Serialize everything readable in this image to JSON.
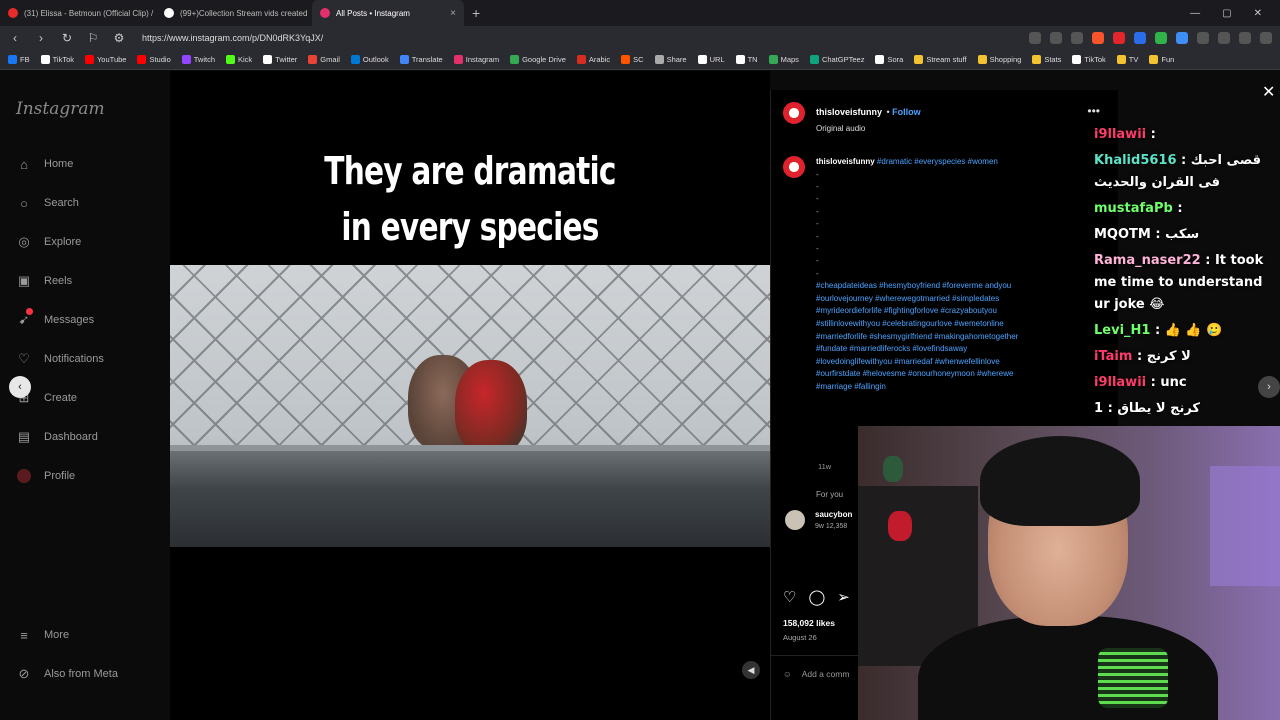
{
  "browser": {
    "tabs": [
      {
        "label": "(31) Elissa - Betmoun (Official Clip) /",
        "color": "#e62b2b"
      },
      {
        "label": "(99+)Collection Stream vids created",
        "color": "#ffffff"
      },
      {
        "label": "All Posts • Instagram",
        "color": "#e1306c",
        "active": true
      }
    ],
    "new_tab": "+",
    "url": "https://www.instagram.com/p/DN0dRK3YqJX/",
    "bookmarks": [
      "FB",
      "TikTok",
      "YouTube",
      "Studio",
      "Twitch",
      "Kick",
      "Twitter",
      "Gmail",
      "Outlook",
      "Translate",
      "Instagram",
      "Google Drive",
      "Arabic",
      "SC",
      "Share",
      "URL",
      "TN",
      "Maps",
      "ChatGPTeez",
      "Sora",
      "Stream stuff",
      "Shopping",
      "Stats",
      "TikTok",
      "TV",
      "Fun"
    ]
  },
  "sidebar": {
    "logo": "Instagram",
    "items": [
      {
        "label": "Home",
        "icon": "home-icon"
      },
      {
        "label": "Search",
        "icon": "search-icon"
      },
      {
        "label": "Explore",
        "icon": "explore-icon"
      },
      {
        "label": "Reels",
        "icon": "reels-icon"
      },
      {
        "label": "Messages",
        "icon": "messages-icon"
      },
      {
        "label": "Notifications",
        "icon": "heart-icon"
      },
      {
        "label": "Create",
        "icon": "plus-icon"
      },
      {
        "label": "Dashboard",
        "icon": "dashboard-icon"
      },
      {
        "label": "Profile",
        "icon": "profile-icon"
      }
    ],
    "bottom": [
      {
        "label": "More",
        "icon": "menu-icon"
      },
      {
        "label": "Also from Meta",
        "icon": "meta-icon"
      }
    ]
  },
  "video": {
    "caption_line1": "They are dramatic",
    "caption_line2": "in every species"
  },
  "post": {
    "username": "thisloveisfunny",
    "follow": "Follow",
    "audio": "Original audio",
    "caption_tags": "#dramatic #everyspecies #women",
    "hashtags": "#cheapdateideas #hesmyboyfriend #foreverme andyou #ourlovejourney #wherewegotmarried #simpledates #myrideordieforlife #fightingforlove #crazyaboutyou #stillinlovewithyou #celebratingourlove #wemetonline #marriedforlife #shesmygirlfriend #makingahometogether #fundate #marriedliferocks #lovefindsaway #lovedoinglifewithyou #marriedaf #whenwefellinlove #ourfirstdate #helovesme #onourhoneymoon #wherewe #marriage #fallingin",
    "age": "11w",
    "for_you": "For you",
    "related_user": "saucybon",
    "related_meta": "9w  12,358",
    "likes": "158,092 likes",
    "date": "August 26",
    "comment_placeholder": "Add a comm"
  },
  "chat": {
    "messages": [
      {
        "user": "i9llawii",
        "text": ":",
        "color": "#ff3b6b"
      },
      {
        "user": "Khalid5616",
        "text": ": قصى احبك فى القران والحديث",
        "color": "#5be3c8"
      },
      {
        "user": "mustafaPb",
        "text": ":",
        "color": "#6fff6a"
      },
      {
        "user": "MQOTM",
        "text": ": سكب",
        "color": "#ffffff"
      },
      {
        "user": "Rama_naser22",
        "text": ": It took me time to understand ur joke 😂",
        "color": "#ffb3d9"
      },
      {
        "user": "Levi_H1",
        "text": ": 👍 👍 🥲",
        "color": "#6fff6a"
      },
      {
        "user": "iTaim",
        "text": ": لا كرنج",
        "color": "#ff3b6b"
      },
      {
        "user": "i9llawii",
        "text": ": unc",
        "color": "#ff3b6b"
      },
      {
        "user": "1",
        "text": ": كرنج لا يطاق",
        "color": "#ffffff"
      }
    ]
  }
}
